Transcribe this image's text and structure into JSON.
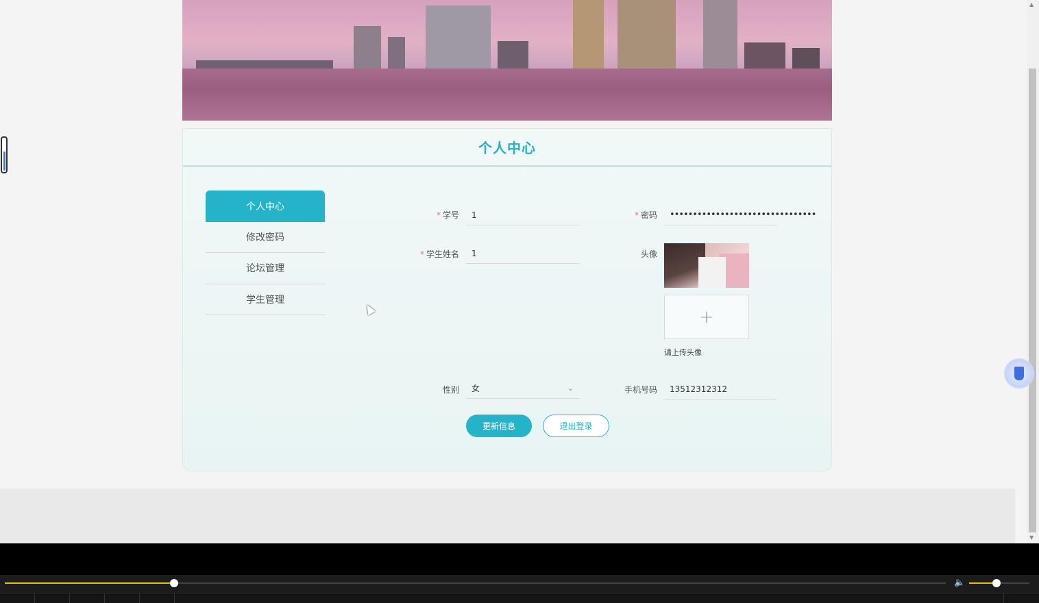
{
  "card": {
    "title": "个人中心"
  },
  "menu": {
    "items": [
      {
        "label": "个人中心"
      },
      {
        "label": "修改密码"
      },
      {
        "label": "论坛管理"
      },
      {
        "label": "学生管理"
      }
    ]
  },
  "form": {
    "student_id": {
      "label": "学号",
      "value": "1",
      "required": "*"
    },
    "password": {
      "label": "密码",
      "value": "••••••••••••••••••••••••••••••••",
      "required": "*"
    },
    "student_name": {
      "label": "学生姓名",
      "value": "1",
      "required": "*"
    },
    "avatar": {
      "label": "头像",
      "upload_tip": "请上传头像",
      "plus": "+"
    },
    "gender": {
      "label": "性别",
      "value": "女"
    },
    "phone": {
      "label": "手机号码",
      "value": "13512312312"
    }
  },
  "buttons": {
    "update": "更新信息",
    "logout": "退出登录"
  },
  "player": {
    "progress": 0.18,
    "volume": 0.45
  },
  "colors": {
    "accent": "#25b3c9",
    "required": "#f56c6c",
    "progress": "#e6c200"
  }
}
